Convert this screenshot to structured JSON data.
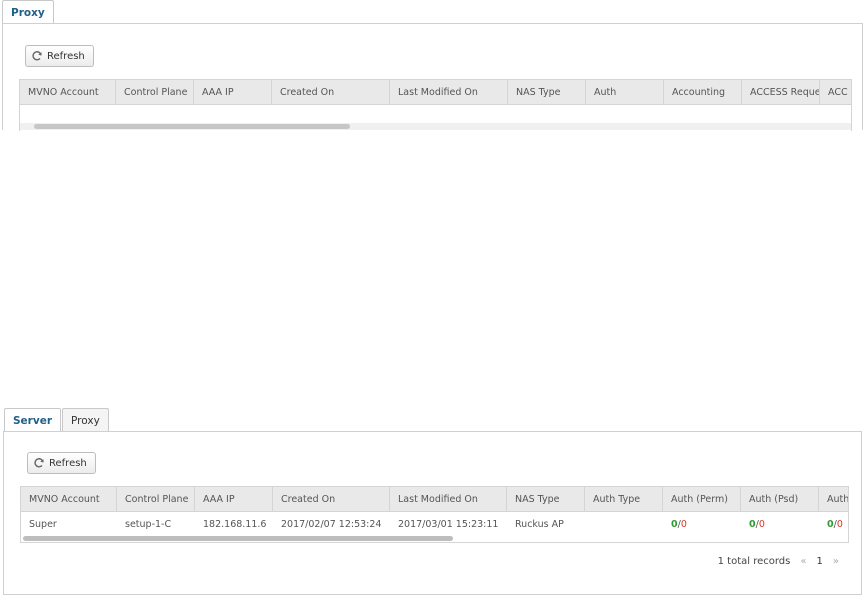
{
  "top_panel": {
    "tabs": [
      {
        "label": "Proxy"
      }
    ],
    "refresh_label": "Refresh",
    "columns": [
      "MVNO Account",
      "Control Plane",
      "AAA IP",
      "Created On",
      "Last Modified On",
      "NAS Type",
      "Auth",
      "Accounting",
      "ACCESS Request",
      "ACC"
    ]
  },
  "bottom_panel": {
    "tabs": [
      {
        "label": "Server"
      },
      {
        "label": "Proxy"
      }
    ],
    "refresh_label": "Refresh",
    "columns": [
      "MVNO Account",
      "Control Plane",
      "AAA IP",
      "Created On",
      "Last Modified On",
      "NAS Type",
      "Auth Type",
      "Auth (Perm)",
      "Auth (Psd)",
      "Auth"
    ],
    "rows": [
      {
        "mvno_account": "Super",
        "control_plane": "setup-1-C",
        "aaa_ip": "182.168.11.6",
        "created_on": "2017/02/07 12:53:24",
        "last_modified_on": "2017/03/01 15:23:11",
        "nas_type": "Ruckus AP",
        "auth_type": "",
        "auth_perm": {
          "ok": "0",
          "sep": "/",
          "fail": "0"
        },
        "auth_psd": {
          "ok": "0",
          "sep": "/",
          "fail": "0"
        },
        "auth": {
          "ok": "0",
          "sep": "/",
          "fail": "0"
        }
      }
    ],
    "pager": {
      "total": "1 total records",
      "prev": "«",
      "page": "1",
      "next": "»"
    }
  },
  "colors": {
    "tab_active_text": "#1f5f8b",
    "ok": "#2e9b2e",
    "fail": "#d9342b"
  }
}
